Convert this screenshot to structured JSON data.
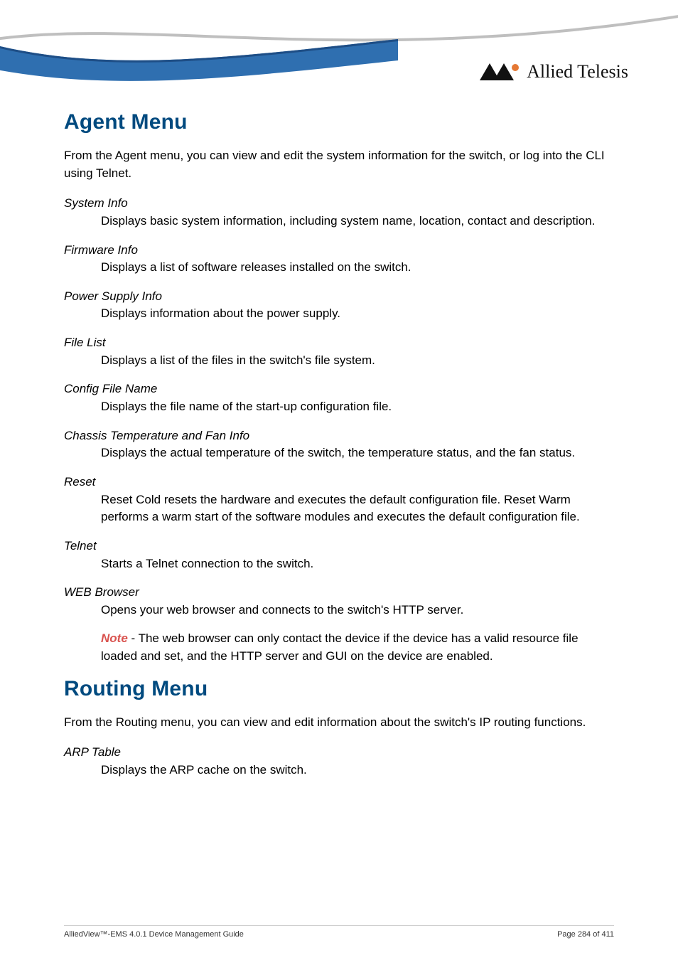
{
  "brand": "Allied Telesis",
  "agent": {
    "title": "Agent Menu",
    "intro": "From the Agent menu, you can view and edit the system information for the switch, or log into the CLI using Telnet.",
    "items": [
      {
        "term": "System Info",
        "desc": "Displays basic system information, including system name, location, contact and description."
      },
      {
        "term": "Firmware Info",
        "desc": "Displays a list of software releases installed on the switch."
      },
      {
        "term": "Power Supply Info",
        "desc": "Displays information about the power supply."
      },
      {
        "term": "File List",
        "desc": "Displays a list of the files in the switch's file system."
      },
      {
        "term": "Config File Name",
        "desc": "Displays the file name of the start-up configuration file."
      },
      {
        "term": "Chassis Temperature and Fan Info",
        "desc": "Displays the actual temperature of the switch, the temperature status, and the fan status."
      },
      {
        "term": "Reset",
        "desc": "Reset Cold resets the hardware and executes the default configuration file. Reset Warm performs a warm start of the software modules and executes the default configuration file."
      },
      {
        "term": "Telnet",
        "desc": "Starts a Telnet connection to the switch."
      }
    ],
    "web_browser": {
      "term": "WEB Browser",
      "desc": "Opens your web browser and connects to the switch's HTTP server.",
      "note_word": "Note",
      "note_rest": " - The web browser can only contact the device if the device has a valid resource file loaded and set, and the HTTP server and GUI on the device are enabled."
    }
  },
  "routing": {
    "title": "Routing Menu",
    "intro": "From the Routing menu, you can view and edit information about the switch's IP routing functions.",
    "items": [
      {
        "term": "ARP Table",
        "desc": "Displays the ARP cache on the switch."
      }
    ]
  },
  "footer": {
    "left": "AlliedView™-EMS 4.0.1 Device Management Guide",
    "right": "Page 284 of 411"
  }
}
